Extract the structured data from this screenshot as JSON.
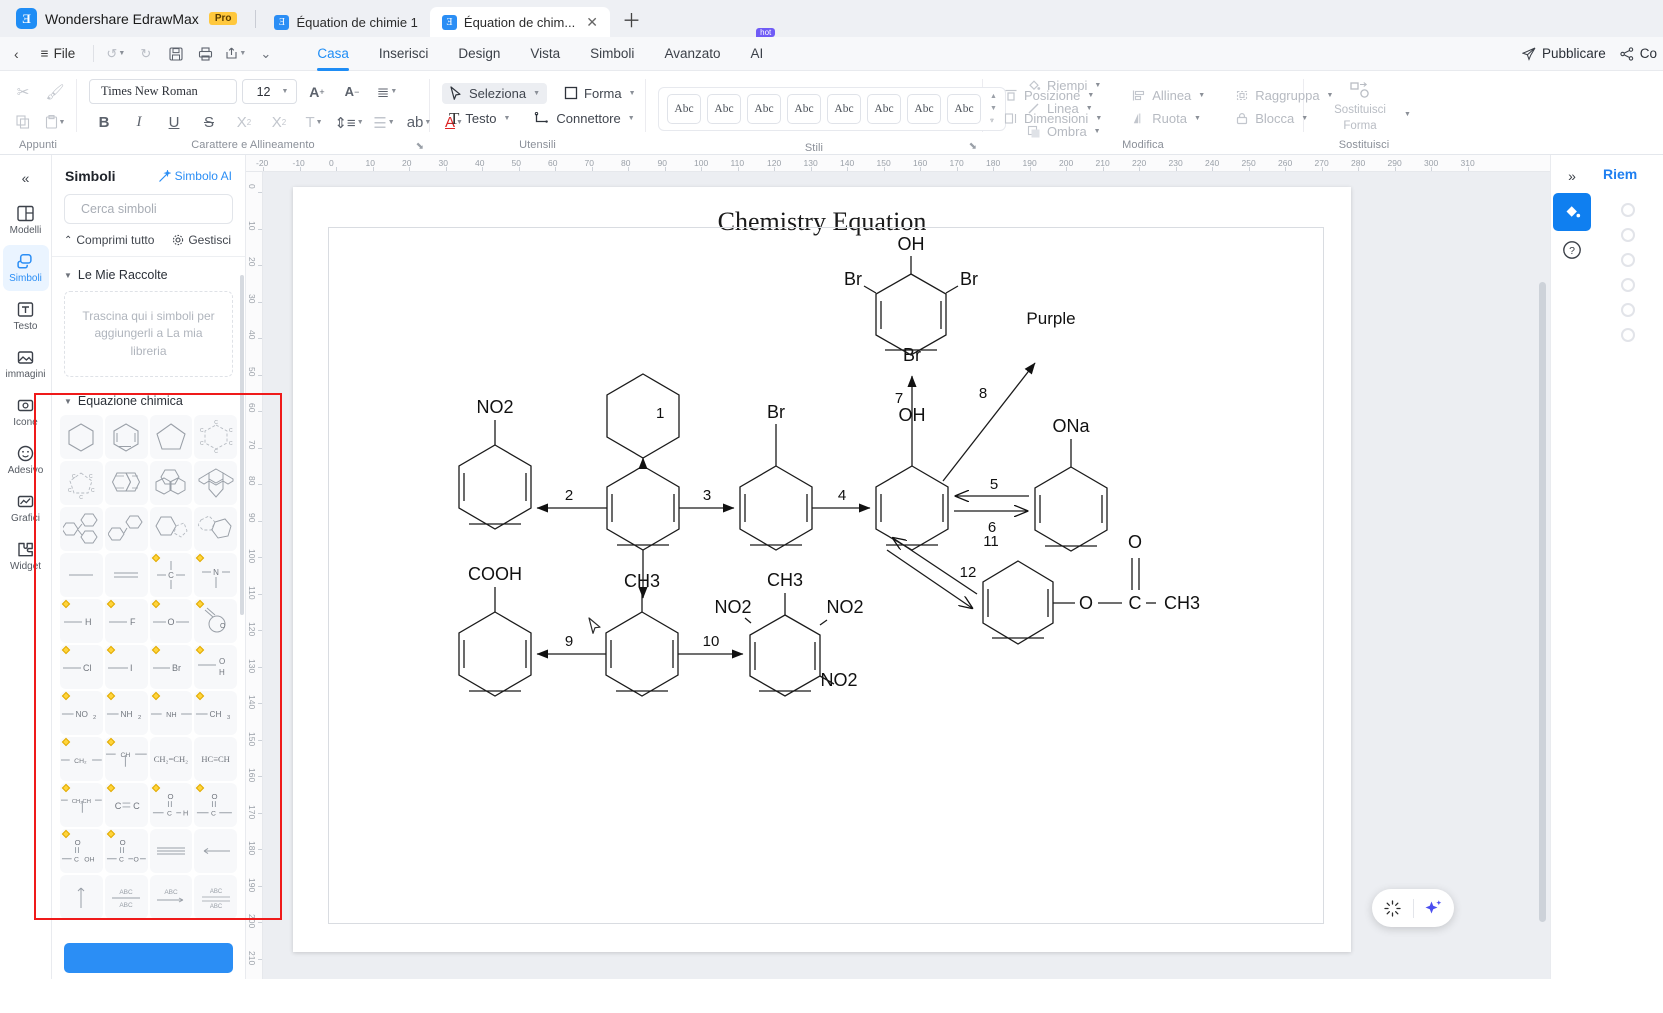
{
  "window": {
    "brand": "Wondershare EdrawMax",
    "pro_badge": "Pro",
    "tabs": [
      {
        "label": "Équation de chimie 1",
        "active": false,
        "closable": false
      },
      {
        "label": "Équation de chim...",
        "active": true,
        "closable": true
      }
    ],
    "new_tab_icon": "plus-icon"
  },
  "menubar": {
    "back_icon": "chevron-left-icon",
    "file_label": "File",
    "quick_actions": [
      {
        "name": "undo-button",
        "icon": "undo-icon",
        "caret": true
      },
      {
        "name": "redo-button",
        "icon": "redo-icon",
        "caret": false
      },
      {
        "name": "save-button",
        "icon": "save-icon",
        "caret": false
      },
      {
        "name": "print-button",
        "icon": "print-icon",
        "caret": false
      },
      {
        "name": "export-button",
        "icon": "export-icon",
        "caret": true
      },
      {
        "name": "more-button",
        "icon": "chevron-down-icon",
        "caret": false
      }
    ],
    "ribbon_tabs": [
      {
        "label": "Casa",
        "active": true
      },
      {
        "label": "Inserisci",
        "active": false
      },
      {
        "label": "Design",
        "active": false
      },
      {
        "label": "Vista",
        "active": false
      },
      {
        "label": "Simboli",
        "active": false
      },
      {
        "label": "Avanzato",
        "active": false
      },
      {
        "label": "AI",
        "active": false,
        "badge": "hot"
      }
    ],
    "publish_label": "Pubblicare",
    "share_label": "Co"
  },
  "ribbon": {
    "groups": [
      {
        "name": "clipboard",
        "label": "Appunti"
      },
      {
        "name": "font-paragraph",
        "label": "Carattere e Allineamento"
      },
      {
        "name": "tools",
        "label": "Utensili"
      },
      {
        "name": "styles",
        "label": "Stili"
      },
      {
        "name": "edit",
        "label": "Modifica"
      },
      {
        "name": "replace",
        "label": "Sostituisci"
      }
    ],
    "font": {
      "family_value": "Times New Roman",
      "size_value": "12",
      "grow_label": "A+",
      "shrink_label": "A-"
    },
    "tools": {
      "select_label": "Seleziona",
      "shape_label": "Forma",
      "text_label": "Testo",
      "connector_label": "Connettore"
    },
    "styles": {
      "swatch_label": "Abc",
      "swatch_count": 8
    },
    "format": {
      "fill_label": "Riempi",
      "line_label": "Linea",
      "shadow_label": "Ombra"
    },
    "edit": {
      "position_label": "Posizione",
      "group_label": "Raggruppa",
      "rotate_label": "Ruota",
      "align_label": "Allinea",
      "size_label": "Dimensioni",
      "lock_label": "Blocca"
    },
    "replace": {
      "line1": "Sostituisci",
      "line2": "Forma"
    }
  },
  "rail": {
    "collapse_icon": "double-chevron-left-icon",
    "items": [
      {
        "label": "Modelli",
        "icon": "templates-icon",
        "active": false
      },
      {
        "label": "Simboli",
        "icon": "symbols-icon",
        "active": true
      },
      {
        "label": "Testo",
        "icon": "text-icon",
        "active": false
      },
      {
        "label": "immagini",
        "icon": "image-icon",
        "active": false
      },
      {
        "label": "Icone",
        "icon": "icons-icon",
        "active": false
      },
      {
        "label": "Adesivo",
        "icon": "sticker-icon",
        "active": false
      },
      {
        "label": "Grafici",
        "icon": "charts-icon",
        "active": false
      },
      {
        "label": "Widget",
        "icon": "widget-icon",
        "active": false
      }
    ]
  },
  "symbols_panel": {
    "title": "Simboli",
    "ai_label": "Simbolo AI",
    "search_placeholder": "Cerca simboli",
    "collapse_all_label": "Comprimi tutto",
    "manage_label": "Gestisci",
    "my_collections_label": "Le Mie Raccolte",
    "dropzone_text": "Trascina qui i simboli per aggiungerli a La mia libreria",
    "section_label": "Equazione chimica",
    "cells": [
      {
        "id": "hexagon",
        "pin": false
      },
      {
        "id": "benzene",
        "pin": false
      },
      {
        "id": "pentagon",
        "pin": false
      },
      {
        "id": "labelled-ring",
        "pin": false
      },
      {
        "id": "cyclopentane-labelled",
        "pin": false
      },
      {
        "id": "naphthalene",
        "pin": false
      },
      {
        "id": "phenanthrene",
        "pin": false
      },
      {
        "id": "pyrene",
        "pin": false
      },
      {
        "id": "triphenyl",
        "pin": false
      },
      {
        "id": "biphenyl",
        "pin": false
      },
      {
        "id": "indole-fused",
        "pin": false
      },
      {
        "id": "indole-fused-2",
        "pin": false
      },
      {
        "id": "single-bond",
        "pin": false
      },
      {
        "id": "double-bond",
        "pin": false
      },
      {
        "id": "carbon-center",
        "pin": true,
        "text": "C"
      },
      {
        "id": "nitrogen-center",
        "pin": true,
        "text": "N"
      },
      {
        "id": "bond-h",
        "pin": true,
        "text": "H"
      },
      {
        "id": "bond-f",
        "pin": true,
        "text": "F"
      },
      {
        "id": "bond-o",
        "pin": true,
        "text": "O"
      },
      {
        "id": "carbonyl-circle",
        "pin": true,
        "text": "O"
      },
      {
        "id": "bond-cl",
        "pin": true,
        "text": "Cl"
      },
      {
        "id": "bond-i",
        "pin": true,
        "text": "I"
      },
      {
        "id": "bond-br",
        "pin": true,
        "text": "Br"
      },
      {
        "id": "bond-oh",
        "pin": true,
        "text": "O H"
      },
      {
        "id": "bond-no2",
        "pin": true,
        "text": "NO2"
      },
      {
        "id": "bond-nh2",
        "pin": true,
        "text": "NH2"
      },
      {
        "id": "bond-nh",
        "pin": true,
        "text": "NH"
      },
      {
        "id": "bond-ch3",
        "pin": true,
        "text": "CH3"
      },
      {
        "id": "bond-ch2",
        "pin": true,
        "text": "CH2"
      },
      {
        "id": "bond-ch",
        "pin": true,
        "text": "CH"
      },
      {
        "id": "ethene",
        "pin": false,
        "text": "CH2=CH2"
      },
      {
        "id": "ethyne",
        "pin": false,
        "text": "HC≡CH"
      },
      {
        "id": "chain-chch",
        "pin": true,
        "text": "CH2CH"
      },
      {
        "id": "c-double-c",
        "pin": true,
        "text": "C = C"
      },
      {
        "id": "aldehyde",
        "pin": true,
        "text": "C—H"
      },
      {
        "id": "ketone",
        "pin": true,
        "text": "C"
      },
      {
        "id": "carboxyl",
        "pin": true,
        "text": "C—OH"
      },
      {
        "id": "ester",
        "pin": true,
        "text": "C—O"
      },
      {
        "id": "triple-line",
        "pin": false
      },
      {
        "id": "arrow-left",
        "pin": false
      },
      {
        "id": "arrow-up-bar",
        "pin": false
      },
      {
        "id": "abc-stack",
        "pin": false,
        "text": "ABC"
      },
      {
        "id": "abc-arrow",
        "pin": false,
        "text": "ABC"
      },
      {
        "id": "abc-double",
        "pin": false,
        "text": "ABC"
      }
    ]
  },
  "canvas": {
    "ruler_h_ticks": [
      "-20",
      "-10",
      "0",
      "10",
      "20",
      "30",
      "40",
      "50",
      "60",
      "70",
      "80",
      "90",
      "100",
      "110",
      "120",
      "130",
      "140",
      "150",
      "160",
      "170",
      "180",
      "190",
      "200",
      "210",
      "220",
      "230",
      "240",
      "250",
      "260",
      "270",
      "280",
      "290",
      "300",
      "310"
    ],
    "ruler_v_ticks": [
      "0",
      "10",
      "20",
      "30",
      "40",
      "50",
      "60",
      "70",
      "80",
      "90",
      "100",
      "110",
      "120",
      "130",
      "140",
      "150",
      "160",
      "170",
      "180",
      "190",
      "200",
      "210"
    ],
    "ai_button_left_icon": "magic-wand-icon",
    "ai_button_right_icon": "sparkle-icon"
  },
  "right_dock": {
    "collapse_icon": "double-chevron-right-icon",
    "fill_icon": "paint-bucket-icon",
    "help_icon": "help-circle-icon",
    "panel_title": "Riem"
  },
  "diagram": {
    "title": "Chemistry Equation",
    "arrow_labels": [
      "1",
      "2",
      "3",
      "4",
      "5",
      "6",
      "7",
      "8",
      "9",
      "10",
      "11",
      "12"
    ],
    "molecule_labels": [
      "NO2",
      "Br",
      "OH",
      "Br",
      "Br",
      "Br",
      "OH",
      "ONa",
      "Purple",
      "COOH",
      "CH3",
      "CH3",
      "NO2",
      "NO2",
      "NO2",
      "O",
      "O",
      "CH3"
    ],
    "nodes": [
      {
        "id": "cyclohexane",
        "substituents": []
      },
      {
        "id": "nitrobenzene",
        "substituents": [
          "NO2"
        ]
      },
      {
        "id": "benzene-center",
        "substituents": []
      },
      {
        "id": "bromobenzene",
        "substituents": [
          "Br"
        ]
      },
      {
        "id": "phenol",
        "substituents": [
          "OH"
        ]
      },
      {
        "id": "tribromophenol",
        "substituents": [
          "OH",
          "Br",
          "Br",
          "Br"
        ]
      },
      {
        "id": "sodium-phenoxide",
        "substituents": [
          "ONa"
        ]
      },
      {
        "id": "benzoic-acid",
        "substituents": [
          "COOH"
        ]
      },
      {
        "id": "toluene",
        "substituents": [
          "CH3"
        ]
      },
      {
        "id": "tnt",
        "substituents": [
          "CH3",
          "NO2",
          "NO2",
          "NO2"
        ]
      },
      {
        "id": "phenyl-acetate",
        "substituents": [
          "O",
          "O",
          "CH3"
        ]
      },
      {
        "id": "purple-product",
        "substituents": [
          "Purple"
        ]
      }
    ]
  },
  "colors": {
    "accent": "#1f8df5",
    "dock_active": "#0f7ff0",
    "highlight_box": "#ef1a1a",
    "pro_badge": "#ffc83d",
    "hot_badge": "#6f5bf6"
  }
}
